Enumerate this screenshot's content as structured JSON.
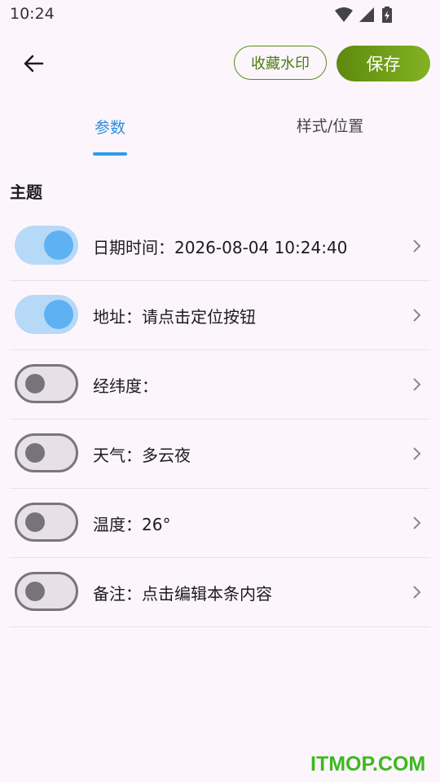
{
  "status": {
    "time": "10:24"
  },
  "toolbar": {
    "collect_label": "收藏水印",
    "save_label": "保存"
  },
  "tabs": [
    {
      "label": "参数",
      "selected": true
    },
    {
      "label": "样式/位置",
      "selected": false
    }
  ],
  "section": {
    "title": "主题"
  },
  "items": [
    {
      "label": "日期时间：2026-08-04 10:24:40",
      "enabled": true
    },
    {
      "label": "地址：请点击定位按钮",
      "enabled": true
    },
    {
      "label": "经纬度：",
      "enabled": false
    },
    {
      "label": "天气：多云夜",
      "enabled": false
    },
    {
      "label": "温度：26°",
      "enabled": false
    },
    {
      "label": "备注：点击编辑本条内容",
      "enabled": false
    }
  ],
  "watermark": {
    "text": "ITMOP.COM"
  },
  "colors": {
    "accent": "#2f8de0",
    "save": "#6f9e18",
    "switch_on": "#5eb2f3",
    "switch_off": "#77737b"
  }
}
